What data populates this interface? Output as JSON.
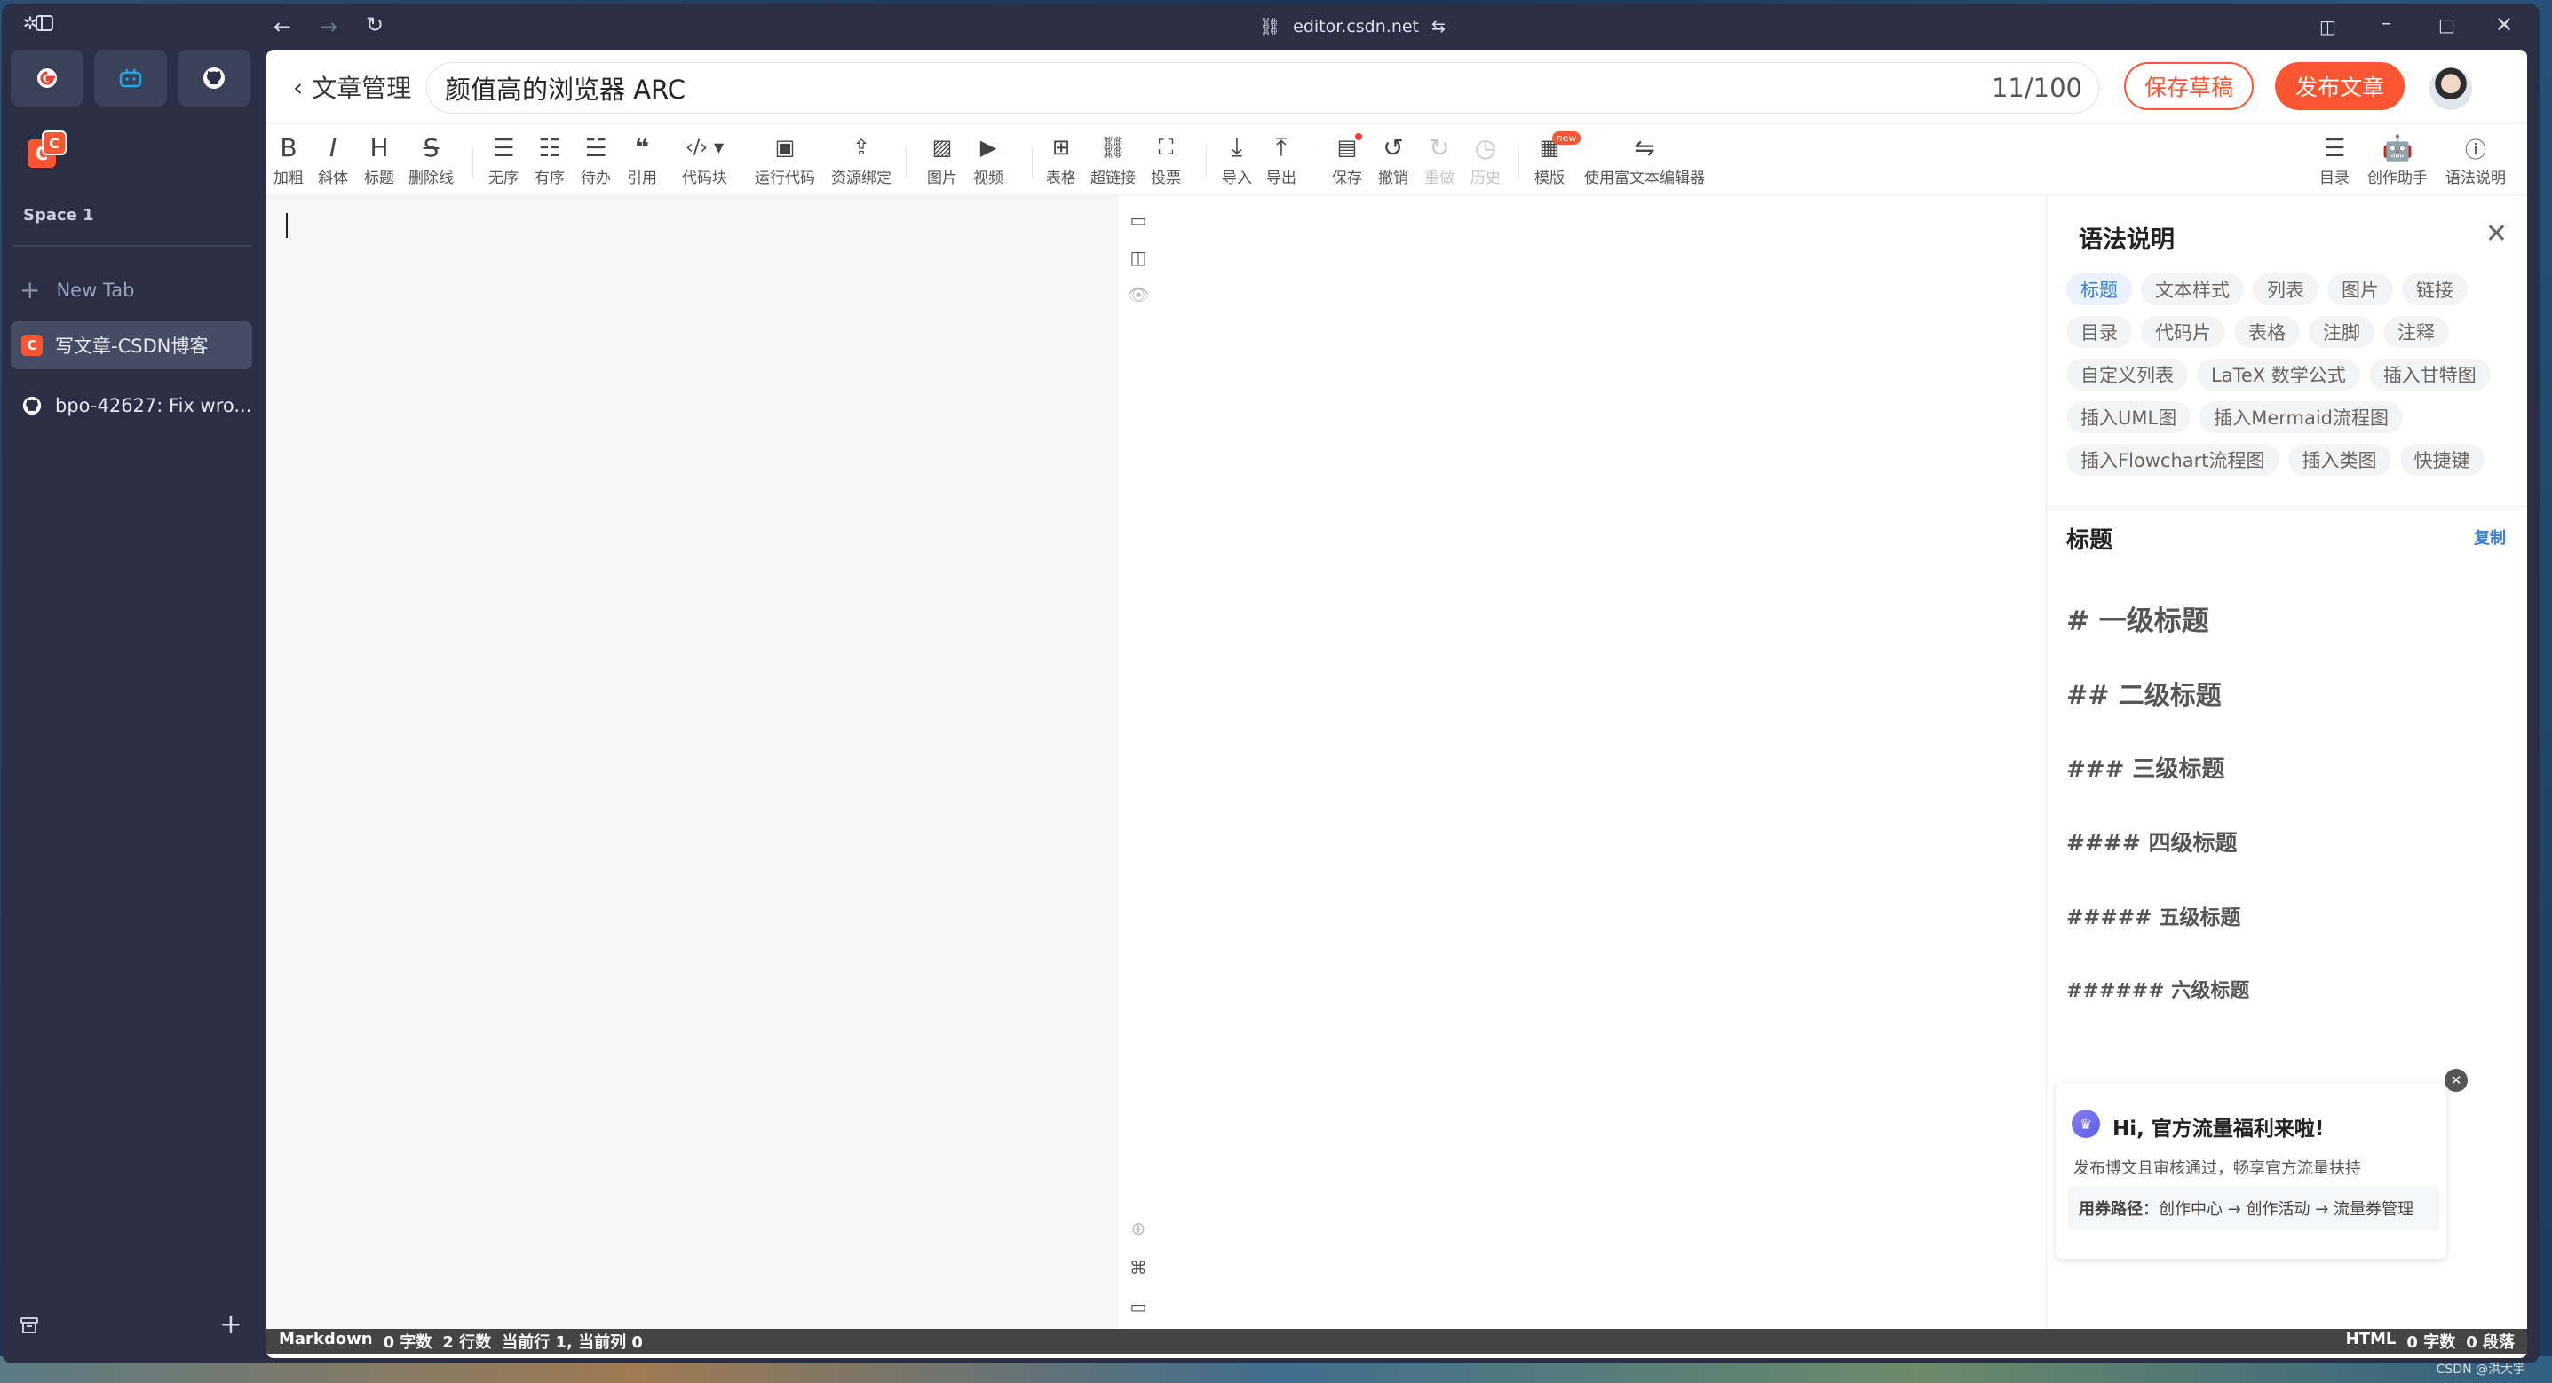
{
  "window": {
    "url": "editor.csdn.net"
  },
  "sidebar": {
    "space_label": "Space 1",
    "new_tab_label": "New Tab",
    "tabs": [
      {
        "label": "写文章-CSDN博客",
        "icon": "csdn-icon",
        "active": true
      },
      {
        "label": "bpo-42627: Fix wro...",
        "icon": "github-icon",
        "active": false
      }
    ],
    "favorites": [
      "google-icon",
      "bilibili-icon",
      "github-icon"
    ],
    "pinned": [
      "csdn-icon"
    ]
  },
  "header": {
    "back_label": "文章管理",
    "title_value": "颜值高的浏览器 ARC",
    "title_count": "11/100",
    "save_draft_label": "保存草稿",
    "publish_label": "发布文章"
  },
  "toolbar": {
    "bold": "加粗",
    "italic": "斜体",
    "heading": "标题",
    "strike": "删除线",
    "ul": "无序",
    "ol": "有序",
    "todo": "待办",
    "quote": "引用",
    "code": "代码块",
    "run": "运行代码",
    "resource": "资源绑定",
    "image": "图片",
    "video": "视频",
    "table": "表格",
    "link": "超链接",
    "vote": "投票",
    "import": "导入",
    "export": "导出",
    "save": "保存",
    "undo": "撤销",
    "redo": "重做",
    "history": "历史",
    "template": "模版",
    "template_badge": "new",
    "rich": "使用富文本编辑器",
    "toc": "目录",
    "assistant": "创作助手",
    "syntax": "语法说明"
  },
  "panel": {
    "title": "语法说明",
    "chips": [
      "标题",
      "文本样式",
      "列表",
      "图片",
      "链接",
      "目录",
      "代码片",
      "表格",
      "注脚",
      "注释",
      "自定义列表",
      "LaTeX 数学公式",
      "插入甘特图",
      "插入UML图",
      "插入Mermaid流程图",
      "插入Flowchart流程图",
      "插入类图",
      "快捷键"
    ],
    "section_title": "标题",
    "copy_label": "复制",
    "headings": [
      "# 一级标题",
      "## 二级标题",
      "### 三级标题",
      "#### 四级标题",
      "##### 五级标题",
      "###### 六级标题"
    ],
    "promo": {
      "title": "Hi, 官方流量福利来啦!",
      "subtitle": "发布博文且审核通过，畅享官方流量扶持",
      "path_label": "用券路径：",
      "path": "创作中心 → 创作活动 → 流量券管理"
    }
  },
  "status": {
    "mode": "Markdown",
    "chars": "0 字数",
    "lines": "2 行数",
    "pos": "当前行 1, 当前列 0",
    "right_mode": "HTML",
    "right_chars": "0 字数",
    "right_paras": "0 段落"
  },
  "watermark": "CSDN @洪大宇"
}
